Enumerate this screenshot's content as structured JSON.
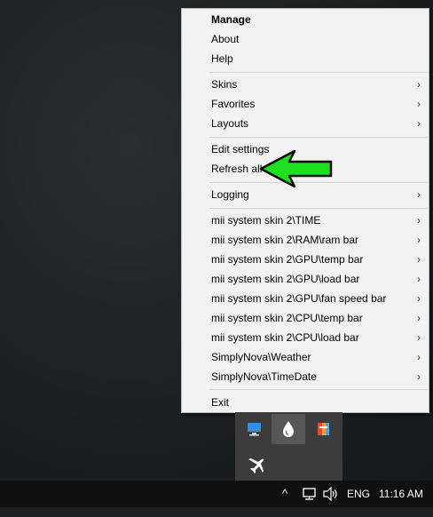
{
  "menu": {
    "items": [
      {
        "label": "Manage",
        "bold": true,
        "submenu": false
      },
      {
        "label": "About",
        "submenu": false
      },
      {
        "label": "Help",
        "submenu": false
      },
      {
        "label": "Skins",
        "submenu": true
      },
      {
        "label": "Favorites",
        "submenu": true
      },
      {
        "label": "Layouts",
        "submenu": true
      },
      {
        "label": "Edit settings",
        "submenu": false
      },
      {
        "label": "Refresh all",
        "submenu": false
      },
      {
        "label": "Logging",
        "submenu": true
      },
      {
        "label": "mii system skin 2\\TIME",
        "submenu": true
      },
      {
        "label": "mii system skin 2\\RAM\\ram bar",
        "submenu": true
      },
      {
        "label": "mii system skin 2\\GPU\\temp bar",
        "submenu": true
      },
      {
        "label": "mii system skin 2\\GPU\\load bar",
        "submenu": true
      },
      {
        "label": "mii system skin 2\\GPU\\fan speed bar",
        "submenu": true
      },
      {
        "label": "mii system skin 2\\CPU\\temp bar",
        "submenu": true
      },
      {
        "label": "mii system skin 2\\CPU\\load bar",
        "submenu": true
      },
      {
        "label": "SimplyNova\\Weather",
        "submenu": true
      },
      {
        "label": "SimplyNova\\TimeDate",
        "submenu": true
      },
      {
        "label": "Exit",
        "submenu": false
      }
    ]
  },
  "annotation": {
    "color": "#1ee01e",
    "icon": "green-arrow-pointer"
  },
  "tray_popup": {
    "icons": [
      "network-monitor-icon",
      "rainmeter-drop-icon",
      "app-tray-icon",
      "airplane-icon"
    ]
  },
  "taskbar": {
    "chevron": "^",
    "language": "ENG",
    "time": "11:16 AM"
  }
}
